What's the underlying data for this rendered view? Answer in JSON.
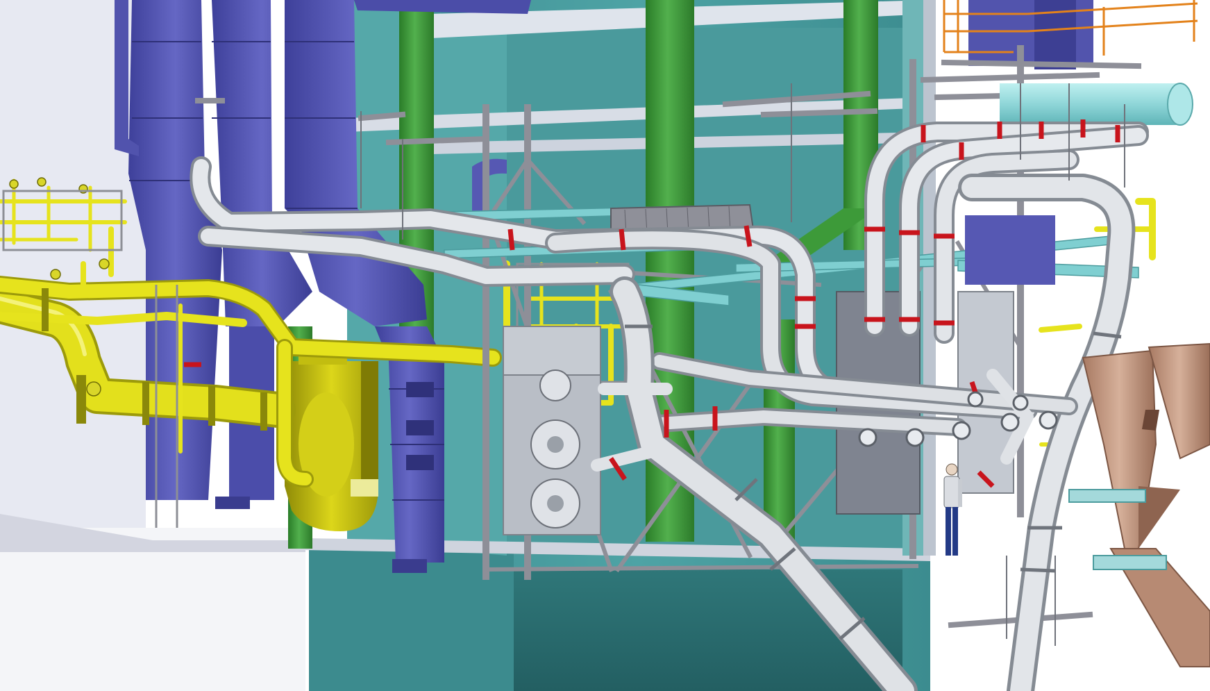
{
  "scene": {
    "colors": {
      "background": "#ffffff",
      "floor_gray": "#e9ebf3",
      "boiler_teal": "#4c9ea0",
      "boiler_teal_dark": "#2f7477",
      "boiler_teal_light": "#6bb9b8",
      "duct_blue": "#5a5cb6",
      "duct_blue_dark": "#393b86",
      "steel_green": "#3f9b3c",
      "steel_green_dark": "#276e27",
      "pipe_yellow": "#e6e31d",
      "pipe_yellow_dark": "#9c9a0b",
      "pipe_silver": "#cdd2d8",
      "pipe_silver_dark": "#8a9097",
      "pipe_red_band": "#c8141c",
      "frame_gray": "#9a9aa3",
      "beam_cyan": "#79c9cb",
      "hopper_brown": "#c69c83",
      "hopper_brown_dark": "#8e6450",
      "fan_olive": "#c8c20f",
      "railing_orange": "#e3821b",
      "worker_blue": "#233a86"
    },
    "objects": [
      "boiler-casing",
      "air-ducts",
      "green-columns",
      "yellow-gas-pipes",
      "silver-coal-pipes",
      "steel-frame",
      "forced-draft-fan",
      "burners",
      "coal-hoppers",
      "stair-railing",
      "worker-figure"
    ]
  }
}
